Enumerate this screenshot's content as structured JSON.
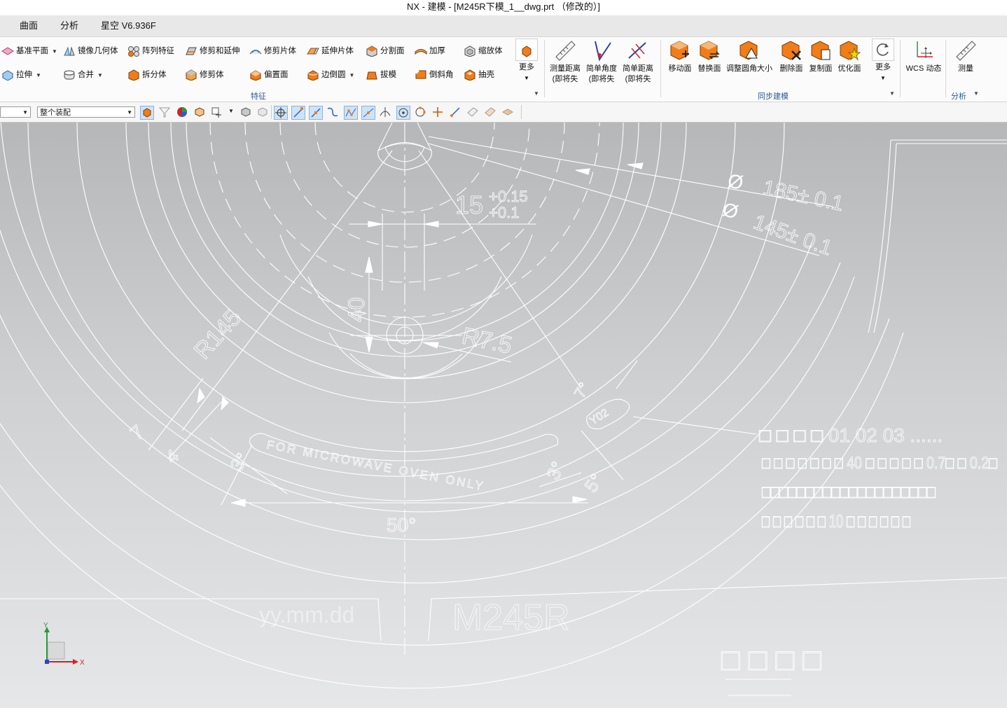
{
  "window": {
    "title": "NX - 建模 - [M245R下模_1__dwg.prt （修改的）]"
  },
  "menubar": {
    "items": [
      "曲面",
      "分析",
      "星空 V6.936F"
    ]
  },
  "ribbon": {
    "row1": [
      "基准平面",
      "镜像几何体",
      "阵列特征",
      "修剪和延伸",
      "修剪片体",
      "延伸片体",
      "分割面",
      "加厚",
      "缩放体"
    ],
    "row2": [
      "拉伸",
      "合并",
      "拆分体",
      "修剪体",
      "偏置面",
      "边倒圆",
      "拔模",
      "倒斜角",
      "抽壳"
    ],
    "more1": "更多",
    "feature_group": "特征",
    "measure_tools": [
      {
        "l1": "测量距离",
        "l2": "(即将失"
      },
      {
        "l1": "简单角度",
        "l2": "(即将失"
      },
      {
        "l1": "简单距离",
        "l2": "(即将失"
      }
    ],
    "sync_tools": [
      "移动面",
      "替换面",
      "调整圆角大小",
      "删除面",
      "复制面",
      "优化面"
    ],
    "more2": "更多",
    "sync_group": "同步建模",
    "wcs": "WCS 动态",
    "measure": "测量",
    "analysis_group": "分析"
  },
  "toolbar2": {
    "filter_value": "",
    "assembly_scope": "整个装配"
  },
  "colors": {
    "accent_orange": "#f07d1a",
    "group_blue": "#2d5a96",
    "drawing_line": "#ffffff"
  },
  "drawing": {
    "dim_185": "185± 0.1",
    "dim_145": "145± 0.1",
    "dim_15": "15",
    "tol_upper": "+0.15",
    "tol_lower": "+0.1",
    "dim_40": "40",
    "r145": "R145",
    "r75": "R7.5",
    "dim_7a": "7",
    "dim_4": "4",
    "angle_3a": "3°",
    "angle_3b": "3°",
    "angle_5": "5°",
    "angle_7": "7°",
    "angle_50": "50°",
    "banner": "FOR MICROWAVE OVEN ONLY",
    "y02": "Y02",
    "date_code": "yy.mm.dd",
    "model": "M245R",
    "note1": "□ □ □ □ 01 02 03 ......",
    "note2": "□ □ □ □ □ □ □ 40 □ □ □ □ □ 0.7□ □ 0.2□",
    "note3": "□□□□□□□□□□□□□□□□□□□□",
    "note4": "□ □ □ □ □ □ 10 □ □ □ □ □ □",
    "note5": "□ □ □ □",
    "axis_x": "X",
    "axis_y": "Y"
  }
}
